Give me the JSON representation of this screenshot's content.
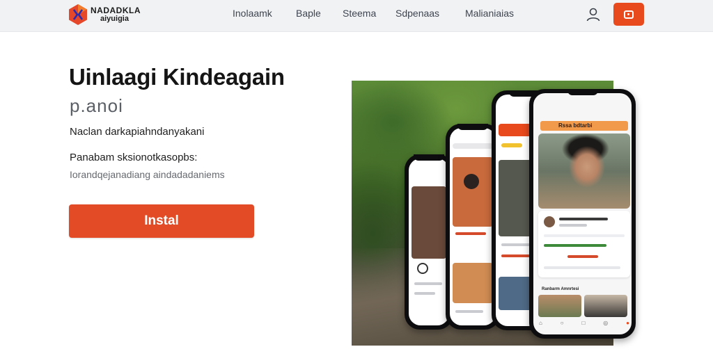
{
  "header": {
    "logo_line1": "NADADKLA",
    "logo_line2": "aiyuigia",
    "nav": [
      "Inolaamk",
      "Baple",
      "Steema",
      "Sdpenaas",
      "Malianiaias"
    ]
  },
  "hero": {
    "title": "Uinlaagi Kindeagain",
    "subtitle": "p.anoi",
    "line1": "Naclan darkapiahndanyakani",
    "line2": "Panabam sksionotkasopbs:",
    "line3": "Iorandqejanadiang aindadadaniems",
    "install_label": "Instal"
  },
  "phone_main": {
    "header_label": "Rssa bdtarbi",
    "section_label": "Ranbarm Amnrtesi"
  },
  "colors": {
    "accent": "#e24b26",
    "header_bg": "#f1f2f4"
  }
}
